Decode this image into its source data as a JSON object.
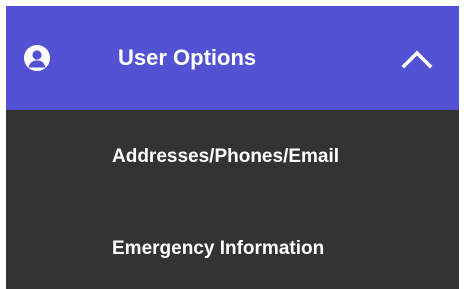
{
  "header": {
    "icon": "user-circle-icon",
    "label": "User Options",
    "toggle_icon": "chevron-up-icon",
    "expanded": true
  },
  "menu": {
    "items": [
      {
        "label": "Addresses/Phones/Email"
      },
      {
        "label": "Emergency Information"
      }
    ]
  },
  "colors": {
    "header_bg": "#5252d3",
    "menu_bg": "#333333",
    "text": "#ffffff",
    "page_bg": "#ffffff"
  }
}
